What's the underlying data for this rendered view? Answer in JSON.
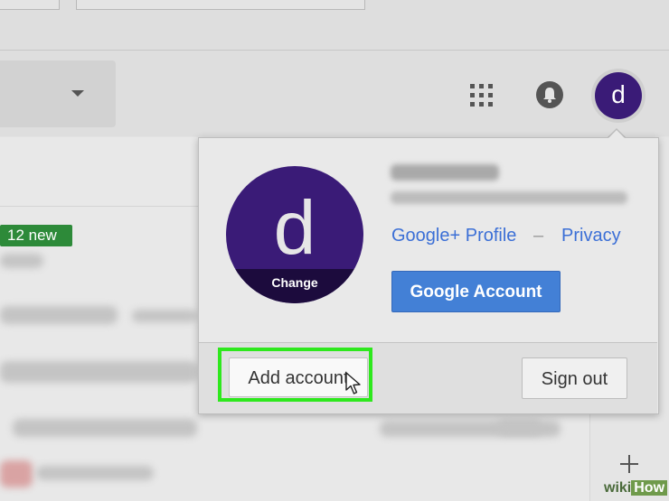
{
  "header": {
    "account_initial": "d"
  },
  "inbox": {
    "new_badge": "12 new"
  },
  "account_popover": {
    "avatar_letter": "d",
    "avatar_change_label": "Change",
    "links": {
      "profile": "Google+ Profile",
      "separator": "–",
      "privacy": "Privacy"
    },
    "google_account_label": "Google Account",
    "add_account_label": "Add account",
    "sign_out_label": "Sign out"
  },
  "watermark": {
    "prefix": "wiki",
    "suffix": "How"
  },
  "colors": {
    "avatar_purple": "#3a1b77",
    "link_blue": "#3b6fd6",
    "primary_button": "#4380d6",
    "highlight_green": "#2ee81d",
    "badge_green": "#2d8a39"
  }
}
